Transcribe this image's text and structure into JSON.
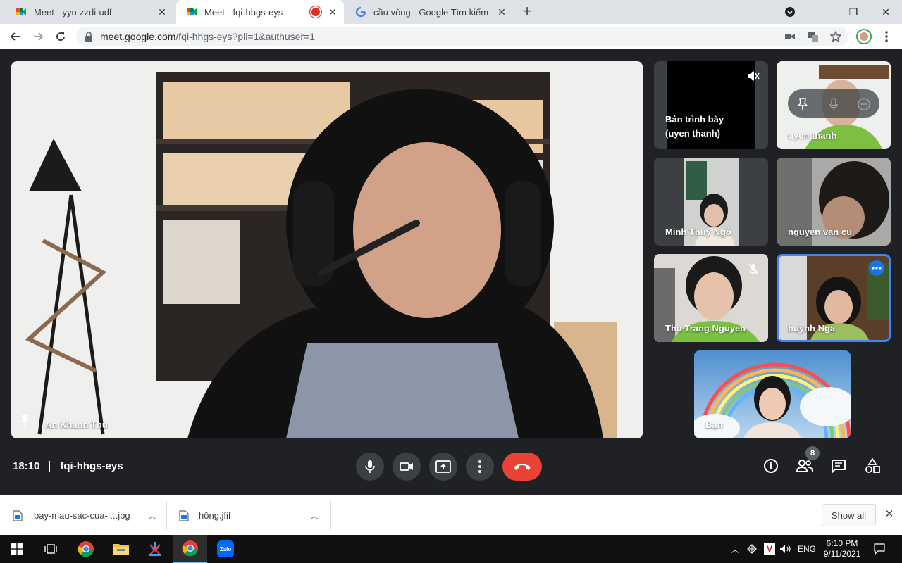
{
  "browser": {
    "tabs": [
      {
        "title": "Meet - yyn-zzdi-udf"
      },
      {
        "title": "Meet - fqi-hhgs-eys"
      },
      {
        "title": "cầu vòng - Google Tìm kiếm"
      }
    ],
    "url_host": "meet.google.com",
    "url_path": "/fqi-hhgs-eys?pli=1&authuser=1"
  },
  "meet": {
    "time": "18:10",
    "meeting_code": "fqi-hhgs-eys",
    "participant_count": "8",
    "main_tile": {
      "name": "An Khanh Thu"
    },
    "tiles": [
      {
        "name": "Bản trình bày\n(uyen thanh)"
      },
      {
        "name": "uyen thanh"
      },
      {
        "name": "Minh Thuỷ Ngô"
      },
      {
        "name": "nguyen van cu"
      },
      {
        "name": "Thu Trang Nguyen"
      },
      {
        "name": "huỳnh Nga"
      },
      {
        "name": "Bạn"
      }
    ]
  },
  "downloads": {
    "items": [
      {
        "filename": "bay-mau-sac-cua-....jpg"
      },
      {
        "filename": "hồng.jfif"
      }
    ],
    "show_all_label": "Show all"
  },
  "taskbar": {
    "language": "ENG",
    "clock_time": "6:10 PM",
    "clock_date": "9/11/2021",
    "zalo_label": "Zalo"
  },
  "colors": {
    "meet_bg": "#202124",
    "end_call": "#ea4335",
    "active_tile_border": "#4285f4"
  }
}
